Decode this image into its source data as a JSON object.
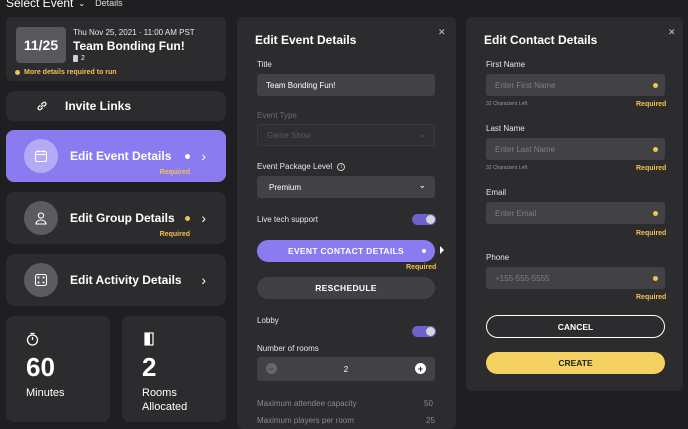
{
  "topbar": {
    "select_event": "Select Event",
    "details": "Details"
  },
  "event_card": {
    "date_badge": "11/25",
    "datetime": "Thu Nov 25, 2021 · 11:00 AM PST",
    "title": "Team Bonding Fun!",
    "guest_count": "2",
    "warning": "More details required to run"
  },
  "menu": {
    "invite_links": "Invite Links",
    "edit_event": "Edit Event Details",
    "edit_group": "Edit Group Details",
    "edit_activity": "Edit Activity Details",
    "required": "Required"
  },
  "stats": {
    "duration_value": "60",
    "duration_label": "Minutes",
    "rooms_value": "2",
    "rooms_label_1": "Rooms",
    "rooms_label_2": "Allocated"
  },
  "event_panel": {
    "heading": "Edit Event Details",
    "title_label": "Title",
    "title_value": "Team Bonding Fun!",
    "event_type_label": "Event Type",
    "event_type_value": "Game Show",
    "package_label": "Event Package Level",
    "package_value": "Premium",
    "live_support_label": "Live tech support",
    "contact_button": "EVENT CONTACT DETAILS",
    "required": "Required",
    "reschedule_button": "RESCHEDULE",
    "lobby_label": "Lobby",
    "rooms_label": "Number of rooms",
    "rooms_value": "2",
    "max_capacity_label": "Maximum attendee capacity",
    "max_capacity_value": "50",
    "max_players_label": "Maximum players per room",
    "max_players_value": "25"
  },
  "contact_panel": {
    "heading": "Edit Contact Details",
    "first_name_label": "First Name",
    "first_name_placeholder": "Enter First Name",
    "chars_left": "32 Characters Left",
    "last_name_label": "Last Name",
    "last_name_placeholder": "Enter Last Name",
    "email_label": "Email",
    "email_placeholder": "Enter Email",
    "phone_label": "Phone",
    "phone_placeholder": "+155-555-5555",
    "required": "Required",
    "cancel_button": "CANCEL",
    "create_button": "CREATE"
  },
  "colors": {
    "accent": "#8a7cf0",
    "warning": "#f2c14e",
    "create": "#f4d160"
  }
}
